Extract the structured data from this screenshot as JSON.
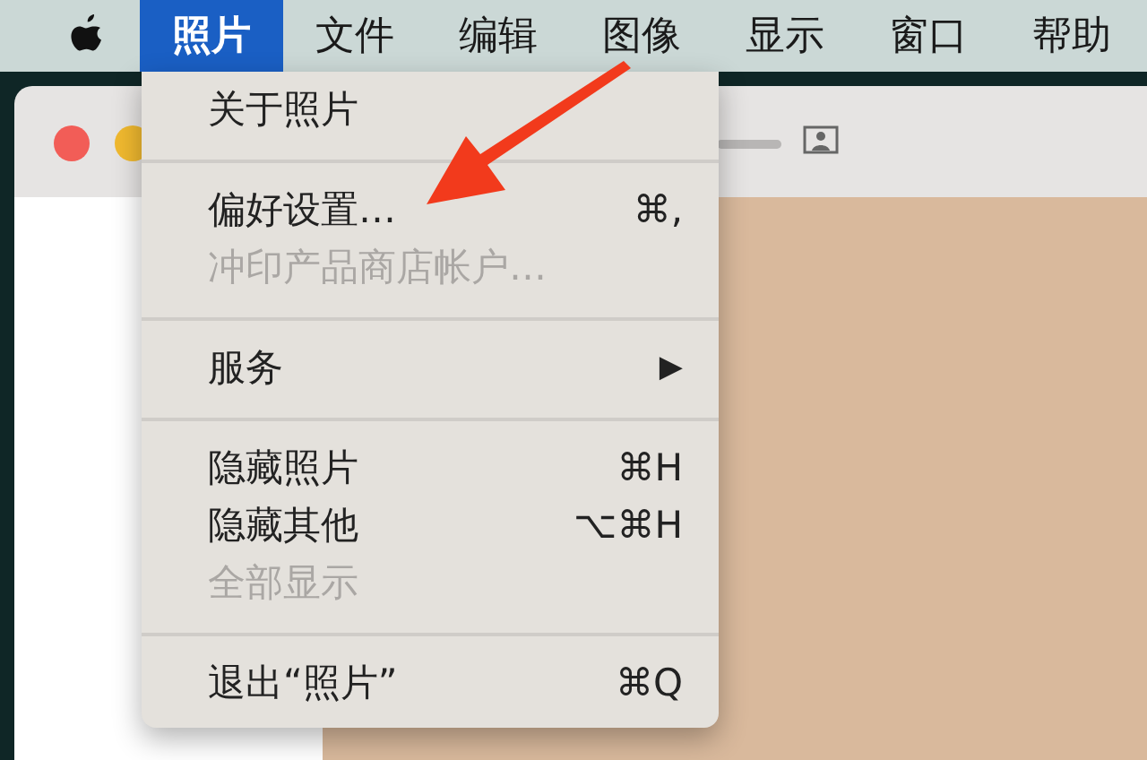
{
  "menu_bar": {
    "items": [
      {
        "label": "照片",
        "selected": true
      },
      {
        "label": "文件",
        "selected": false
      },
      {
        "label": "编辑",
        "selected": false
      },
      {
        "label": "图像",
        "selected": false
      },
      {
        "label": "显示",
        "selected": false
      },
      {
        "label": "窗口",
        "selected": false
      },
      {
        "label": "帮助",
        "selected": false
      }
    ]
  },
  "menu": {
    "entries": [
      {
        "kind": "item",
        "label": "关于照片",
        "disabled": false
      },
      {
        "kind": "separator"
      },
      {
        "kind": "item",
        "label": "偏好设置…",
        "shortcut": "⌘,",
        "disabled": false
      },
      {
        "kind": "item",
        "label": "冲印产品商店帐户…",
        "disabled": true
      },
      {
        "kind": "separator"
      },
      {
        "kind": "submenu",
        "label": "服务",
        "arrow": "▶",
        "disabled": false
      },
      {
        "kind": "separator"
      },
      {
        "kind": "item",
        "label": "隐藏照片",
        "shortcut": "⌘H",
        "disabled": false
      },
      {
        "kind": "item",
        "label": "隐藏其他",
        "shortcut": "⌥⌘H",
        "disabled": false
      },
      {
        "kind": "item",
        "label": "全部显示",
        "disabled": true
      },
      {
        "kind": "separator"
      },
      {
        "kind": "item",
        "label": "退出“照片”",
        "shortcut": "⌘Q",
        "disabled": false
      }
    ]
  }
}
